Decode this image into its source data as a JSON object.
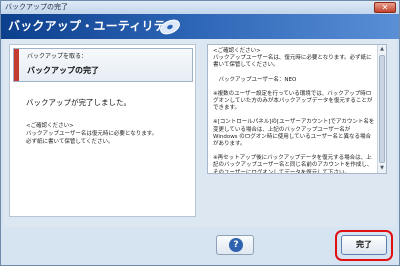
{
  "window": {
    "title": "バックアップの完了",
    "close_glyph": "✕"
  },
  "banner": {
    "title": "バックアップ・ユーティリティ",
    "icon": "disc-icon"
  },
  "step": {
    "label": "バックアップを取る：",
    "title": "バックアップの完了"
  },
  "left": {
    "message": "バックアップが完了しました。",
    "note_heading": "<ご確認ください>",
    "note_lines": [
      "バックアップユーザー名は復元時に必要となります。",
      "必ず紙に書いて保管してください。"
    ]
  },
  "right": {
    "paragraphs": [
      "<ご確認ください>\nバックアップユーザー名は、復元時に必要となります。必ず紙に書いて保管してください。",
      "　バックアップユーザー名：NEO",
      "※複数のユーザー設定を行っている環境では、バックアップ時ログオンしていた方のみが本バックアップデータを復元することができます。",
      "※[コントロールパネル]の[ユーザーアカウント]でアカウント名を変更している場合は、上記のバックアップユーザー名が Windows のログオン時に使用しているユーザー名と異なる場合があります。",
      "※再セットアップ後にバックアップデータを復元する場合は、上記のバックアップユーザー名と同じ名前のアカウントを作成し、そのユーザーにログオンしてデータを復元して下さい。"
    ],
    "scroll_up": "▲",
    "scroll_down": "▼"
  },
  "buttons": {
    "help_glyph": "?",
    "finish": "完了"
  },
  "colors": {
    "banner": "#0c3f8c",
    "highlight": "#e01010",
    "step_marker": "#c43b2f"
  }
}
